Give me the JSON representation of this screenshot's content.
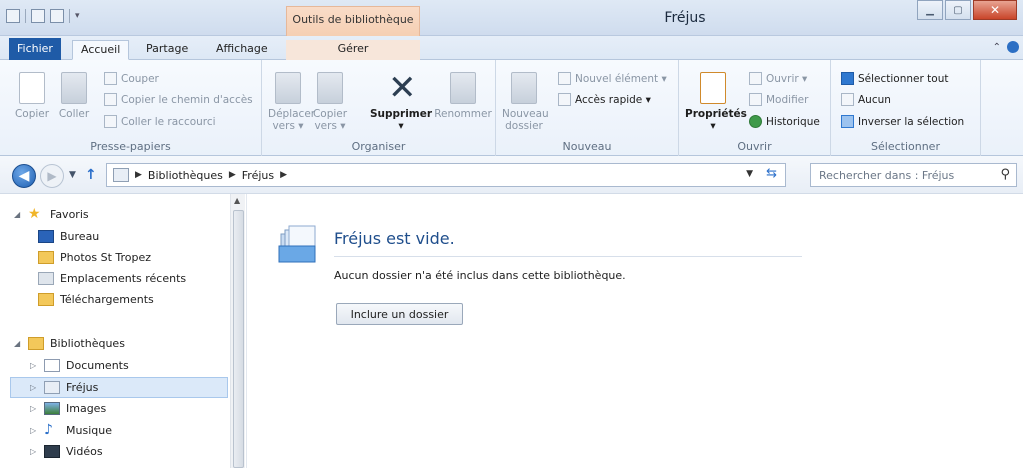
{
  "window": {
    "title": "Fréjus",
    "tool_tab": "Outils de bibliothèque"
  },
  "tabs": {
    "fichier": "Fichier",
    "accueil": "Accueil",
    "partage": "Partage",
    "affichage": "Affichage",
    "gerer": "Gérer"
  },
  "ribbon": {
    "presse_papiers": {
      "label": "Presse-papiers",
      "copier": "Copier",
      "coller": "Coller",
      "couper": "Couper",
      "copier_chemin": "Copier le chemin d'accès",
      "coller_raccourci": "Coller le raccourci"
    },
    "organiser": {
      "label": "Organiser",
      "deplacer_l1": "Déplacer",
      "deplacer_l2": "vers ▾",
      "copier_l1": "Copier",
      "copier_l2": "vers ▾",
      "supprimer": "Supprimer",
      "renommer": "Renommer"
    },
    "nouveau": {
      "label": "Nouveau",
      "dossier_l1": "Nouveau",
      "dossier_l2": "dossier",
      "element": "Nouvel élément ▾",
      "acces_rapide": "Accès rapide ▾"
    },
    "ouvrir": {
      "label": "Ouvrir",
      "proprietes": "Propriétés",
      "ouvrir": "Ouvrir ▾",
      "modifier": "Modifier",
      "historique": "Historique"
    },
    "selectionner": {
      "label": "Sélectionner",
      "tout": "Sélectionner tout",
      "aucun": "Aucun",
      "inverser": "Inverser la sélection"
    }
  },
  "address": {
    "crumb1": "Bibliothèques",
    "crumb2": "Fréjus",
    "search_placeholder": "Rechercher dans : Fréjus"
  },
  "nav": {
    "favoris": "Favoris",
    "favorites": [
      "Bureau",
      "Photos St Tropez",
      "Emplacements récents",
      "Téléchargements"
    ],
    "bibliotheques": "Bibliothèques",
    "libraries": [
      "Documents",
      "Fréjus",
      "Images",
      "Musique",
      "Vidéos"
    ]
  },
  "content": {
    "title": "Fréjus est vide.",
    "description": "Aucun dossier n'a été inclus dans cette bibliothèque.",
    "button": "Inclure un dossier"
  },
  "colors": {
    "accent": "#1f5ba7",
    "tool_tab": "#f5cfb3",
    "link_title": "#1f4e8c"
  }
}
